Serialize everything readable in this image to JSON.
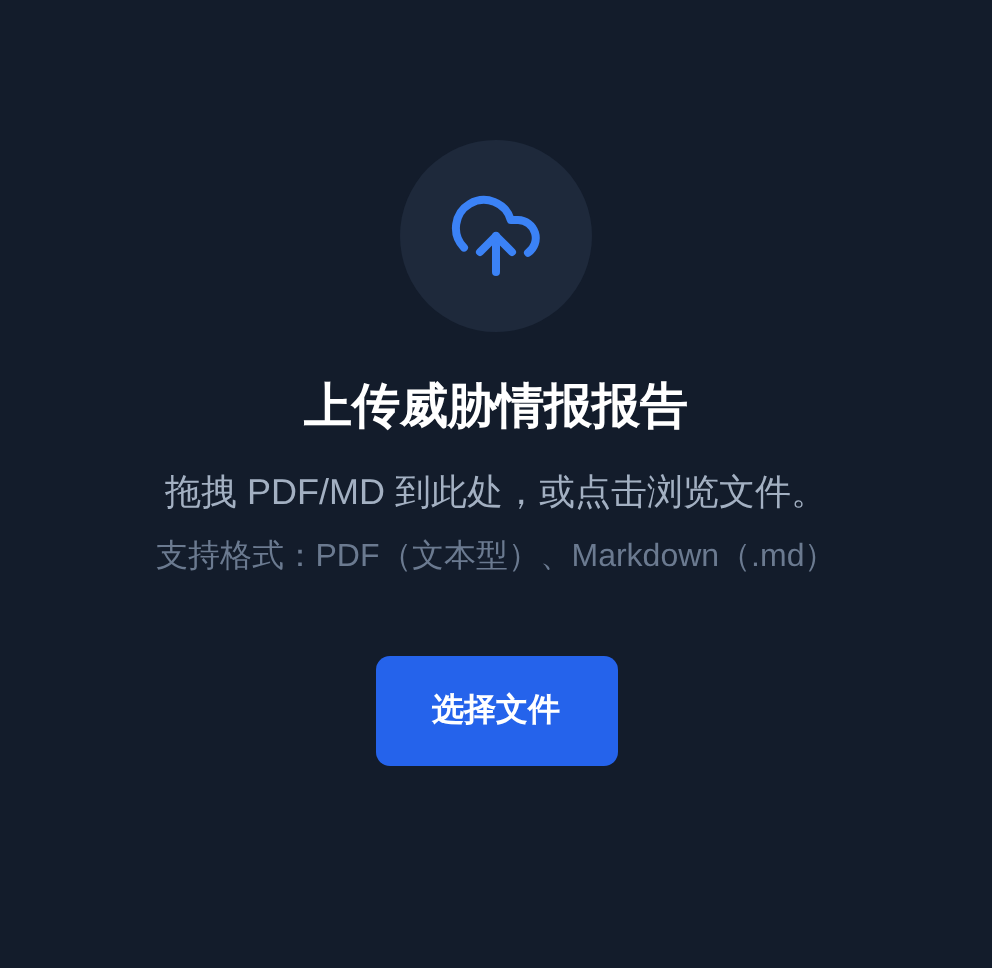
{
  "upload": {
    "title": "上传威胁情报报告",
    "hint": "拖拽 PDF/MD 到此处，或点击浏览文件。",
    "formats": "支持格式：PDF（文本型）、Markdown（.md）",
    "button": "选择文件"
  }
}
